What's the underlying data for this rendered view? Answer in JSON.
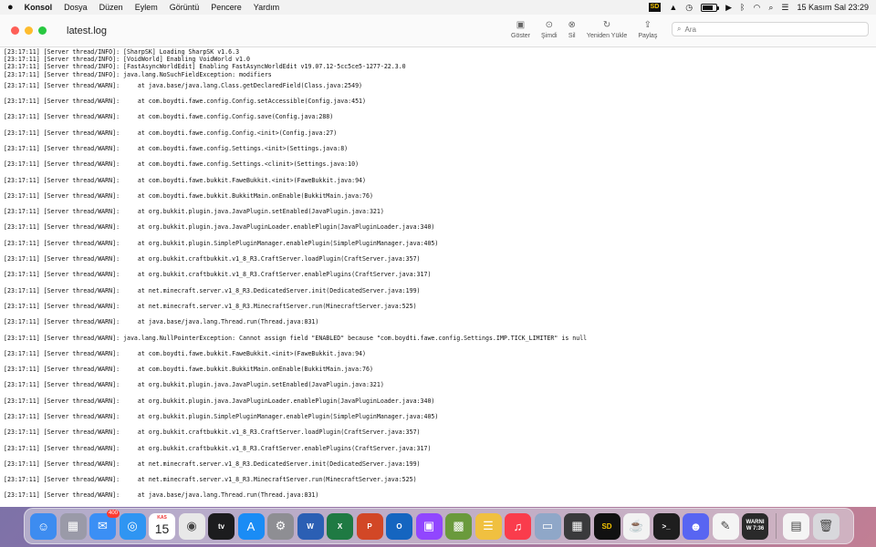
{
  "menubar": {
    "apple_icon": "apple-icon",
    "items": [
      "Konsol",
      "Dosya",
      "Düzen",
      "Eylem",
      "Görüntü",
      "Pencere",
      "Yardım"
    ],
    "status": {
      "sf_label": "SD",
      "clock": "15 Kasım Sal  23:29",
      "battery_level": 0.75
    }
  },
  "window": {
    "title": "latest.log",
    "toolbar": [
      {
        "label": "Göster",
        "icon": "sidebar-icon"
      },
      {
        "label": "Şimdi",
        "icon": "now-icon"
      },
      {
        "label": "Sil",
        "icon": "clear-icon"
      },
      {
        "label": "Yeniden Yükle",
        "icon": "reload-icon"
      },
      {
        "label": "Paylaş",
        "icon": "share-icon"
      }
    ],
    "search": {
      "placeholder": "Ara"
    }
  },
  "log": {
    "lines": [
      {
        "text": "[23:17:11] [Server thread/INFO]: [SharpSK] Loading SharpSK v1.6.3",
        "type": "info"
      },
      {
        "text": "[23:17:11] [Server thread/INFO]: [VoidWorld] Enabling VoidWorld v1.0",
        "type": "info"
      },
      {
        "text": "[23:17:11] [Server thread/INFO]: [FastAsyncWorldEdit] Enabling FastAsyncWorldEdit v19.07.12-5cc5ce5-1277-22.3.0",
        "type": "info"
      },
      {
        "text": "[23:17:11] [Server thread/INFO]: java.lang.NoSuchFieldException: modifiers",
        "type": "info"
      },
      {
        "text": "[23:17:11] [Server thread/WARN]:     at java.base/java.lang.Class.getDeclaredField(Class.java:2549)",
        "type": "warn"
      },
      {
        "text": "[23:17:11] [Server thread/WARN]:     at com.boydti.fawe.config.Config.setAccessible(Config.java:451)",
        "type": "warn"
      },
      {
        "text": "[23:17:11] [Server thread/WARN]:     at com.boydti.fawe.config.Config.save(Config.java:288)",
        "type": "warn"
      },
      {
        "text": "[23:17:11] [Server thread/WARN]:     at com.boydti.fawe.config.Config.<init>(Config.java:27)",
        "type": "warn"
      },
      {
        "text": "[23:17:11] [Server thread/WARN]:     at com.boydti.fawe.config.Settings.<init>(Settings.java:8)",
        "type": "warn"
      },
      {
        "text": "[23:17:11] [Server thread/WARN]:     at com.boydti.fawe.config.Settings.<clinit>(Settings.java:10)",
        "type": "warn"
      },
      {
        "text": "[23:17:11] [Server thread/WARN]:     at com.boydti.fawe.bukkit.FaweBukkit.<init>(FaweBukkit.java:94)",
        "type": "warn"
      },
      {
        "text": "[23:17:11] [Server thread/WARN]:     at com.boydti.fawe.bukkit.BukkitMain.onEnable(BukkitMain.java:76)",
        "type": "warn"
      },
      {
        "text": "[23:17:11] [Server thread/WARN]:     at org.bukkit.plugin.java.JavaPlugin.setEnabled(JavaPlugin.java:321)",
        "type": "warn"
      },
      {
        "text": "[23:17:11] [Server thread/WARN]:     at org.bukkit.plugin.java.JavaPluginLoader.enablePlugin(JavaPluginLoader.java:340)",
        "type": "warn"
      },
      {
        "text": "[23:17:11] [Server thread/WARN]:     at org.bukkit.plugin.SimplePluginManager.enablePlugin(SimplePluginManager.java:405)",
        "type": "warn"
      },
      {
        "text": "[23:17:11] [Server thread/WARN]:     at org.bukkit.craftbukkit.v1_8_R3.CraftServer.loadPlugin(CraftServer.java:357)",
        "type": "warn"
      },
      {
        "text": "[23:17:11] [Server thread/WARN]:     at org.bukkit.craftbukkit.v1_8_R3.CraftServer.enablePlugins(CraftServer.java:317)",
        "type": "warn"
      },
      {
        "text": "[23:17:11] [Server thread/WARN]:     at net.minecraft.server.v1_8_R3.DedicatedServer.init(DedicatedServer.java:199)",
        "type": "warn"
      },
      {
        "text": "[23:17:11] [Server thread/WARN]:     at net.minecraft.server.v1_8_R3.MinecraftServer.run(MinecraftServer.java:525)",
        "type": "warn"
      },
      {
        "text": "[23:17:11] [Server thread/WARN]:     at java.base/java.lang.Thread.run(Thread.java:831)",
        "type": "warn"
      },
      {
        "text": "[23:17:11] [Server thread/WARN]: java.lang.NullPointerException: Cannot assign field \"ENABLED\" because \"com.boydti.fawe.config.Settings.IMP.TICK_LIMITER\" is null",
        "type": "warn"
      },
      {
        "text": "[23:17:11] [Server thread/WARN]:     at com.boydti.fawe.bukkit.FaweBukkit.<init>(FaweBukkit.java:94)",
        "type": "warn"
      },
      {
        "text": "[23:17:11] [Server thread/WARN]:     at com.boydti.fawe.bukkit.BukkitMain.onEnable(BukkitMain.java:76)",
        "type": "warn"
      },
      {
        "text": "[23:17:11] [Server thread/WARN]:     at org.bukkit.plugin.java.JavaPlugin.setEnabled(JavaPlugin.java:321)",
        "type": "warn"
      },
      {
        "text": "[23:17:11] [Server thread/WARN]:     at org.bukkit.plugin.java.JavaPluginLoader.enablePlugin(JavaPluginLoader.java:340)",
        "type": "warn"
      },
      {
        "text": "[23:17:11] [Server thread/WARN]:     at org.bukkit.plugin.SimplePluginManager.enablePlugin(SimplePluginManager.java:405)",
        "type": "warn"
      },
      {
        "text": "[23:17:11] [Server thread/WARN]:     at org.bukkit.craftbukkit.v1_8_R3.CraftServer.loadPlugin(CraftServer.java:357)",
        "type": "warn"
      },
      {
        "text": "[23:17:11] [Server thread/WARN]:     at org.bukkit.craftbukkit.v1_8_R3.CraftServer.enablePlugins(CraftServer.java:317)",
        "type": "warn"
      },
      {
        "text": "[23:17:11] [Server thread/WARN]:     at net.minecraft.server.v1_8_R3.DedicatedServer.init(DedicatedServer.java:199)",
        "type": "warn"
      },
      {
        "text": "[23:17:11] [Server thread/WARN]:     at net.minecraft.server.v1_8_R3.MinecraftServer.run(MinecraftServer.java:525)",
        "type": "warn"
      },
      {
        "text": "[23:17:11] [Server thread/WARN]:     at java.base/java.lang.Thread.run(Thread.java:831)",
        "type": "warn"
      }
    ]
  },
  "dock": {
    "apps": [
      {
        "name": "finder",
        "icon": "finder-icon",
        "color": "#3d8cf0",
        "glyph": "☺"
      },
      {
        "name": "launchpad",
        "icon": "launchpad-icon",
        "color": "#9a9aa8",
        "glyph": "▦"
      },
      {
        "name": "mail",
        "icon": "mail-icon",
        "color": "#3b8ff5",
        "glyph": "✉",
        "badge": "400"
      },
      {
        "name": "safari",
        "icon": "safari-icon",
        "color": "#2f95f2",
        "glyph": "◎"
      },
      {
        "name": "calendar",
        "icon": "calendar-icon",
        "color": "#ffffff",
        "month": "KAS",
        "day": "15"
      },
      {
        "name": "chrome",
        "icon": "chrome-icon",
        "color": "#e8e8e8",
        "glyph": "◉"
      },
      {
        "name": "apple-tv",
        "icon": "tv-icon",
        "color": "#1c1c1e",
        "text": "tv"
      },
      {
        "name": "app-store",
        "icon": "app-store-icon",
        "color": "#1a8cf5",
        "glyph": "A"
      },
      {
        "name": "system-preferences",
        "icon": "gear-icon",
        "color": "#8e8e93",
        "glyph": "⚙"
      },
      {
        "name": "word",
        "icon": "word-icon",
        "color": "#2b5fb4",
        "text": "W"
      },
      {
        "name": "excel",
        "icon": "excel-icon",
        "color": "#1f7a43",
        "text": "X"
      },
      {
        "name": "powerpoint",
        "icon": "powerpoint-icon",
        "color": "#d24726",
        "text": "P"
      },
      {
        "name": "outlook",
        "icon": "outlook-icon",
        "color": "#1565c0",
        "text": "O"
      },
      {
        "name": "twitch",
        "icon": "twitch-icon",
        "color": "#9146ff",
        "glyph": "▣"
      },
      {
        "name": "minecraft",
        "icon": "minecraft-icon",
        "color": "#6a9a3c",
        "glyph": "▩"
      },
      {
        "name": "notes-list",
        "icon": "list-icon",
        "color": "#f0c040",
        "glyph": "☰"
      },
      {
        "name": "music",
        "icon": "music-icon",
        "color": "#fa3c4c",
        "glyph": "♫"
      },
      {
        "name": "preview",
        "icon": "preview-icon",
        "color": "#8fa7c8",
        "glyph": "▭"
      },
      {
        "name": "calculator",
        "icon": "calculator-icon",
        "color": "#3a3a3c",
        "glyph": "▦"
      },
      {
        "name": "sf-app",
        "icon": "sf-icon",
        "color": "#111111",
        "text": "SD"
      },
      {
        "name": "java",
        "icon": "java-icon",
        "color": "#f2f2f2",
        "glyph": "☕"
      },
      {
        "name": "terminal",
        "icon": "terminal-icon",
        "color": "#1e1e1e",
        "text": ">_"
      },
      {
        "name": "discord",
        "icon": "discord-icon",
        "color": "#5865f2",
        "glyph": "☻"
      },
      {
        "name": "textedit",
        "icon": "textedit-icon",
        "color": "#f4f4f4",
        "glyph": "✎"
      },
      {
        "name": "console",
        "icon": "console-icon",
        "color": "#2a2a2a",
        "text": "WARNI\nW 7:36"
      }
    ],
    "right_apps": [
      {
        "name": "document",
        "icon": "document-icon",
        "color": "#f4f4f4",
        "glyph": "▤"
      },
      {
        "name": "trash",
        "icon": "trash-icon",
        "color": "#d8d8dc",
        "glyph": "🗑"
      }
    ]
  }
}
